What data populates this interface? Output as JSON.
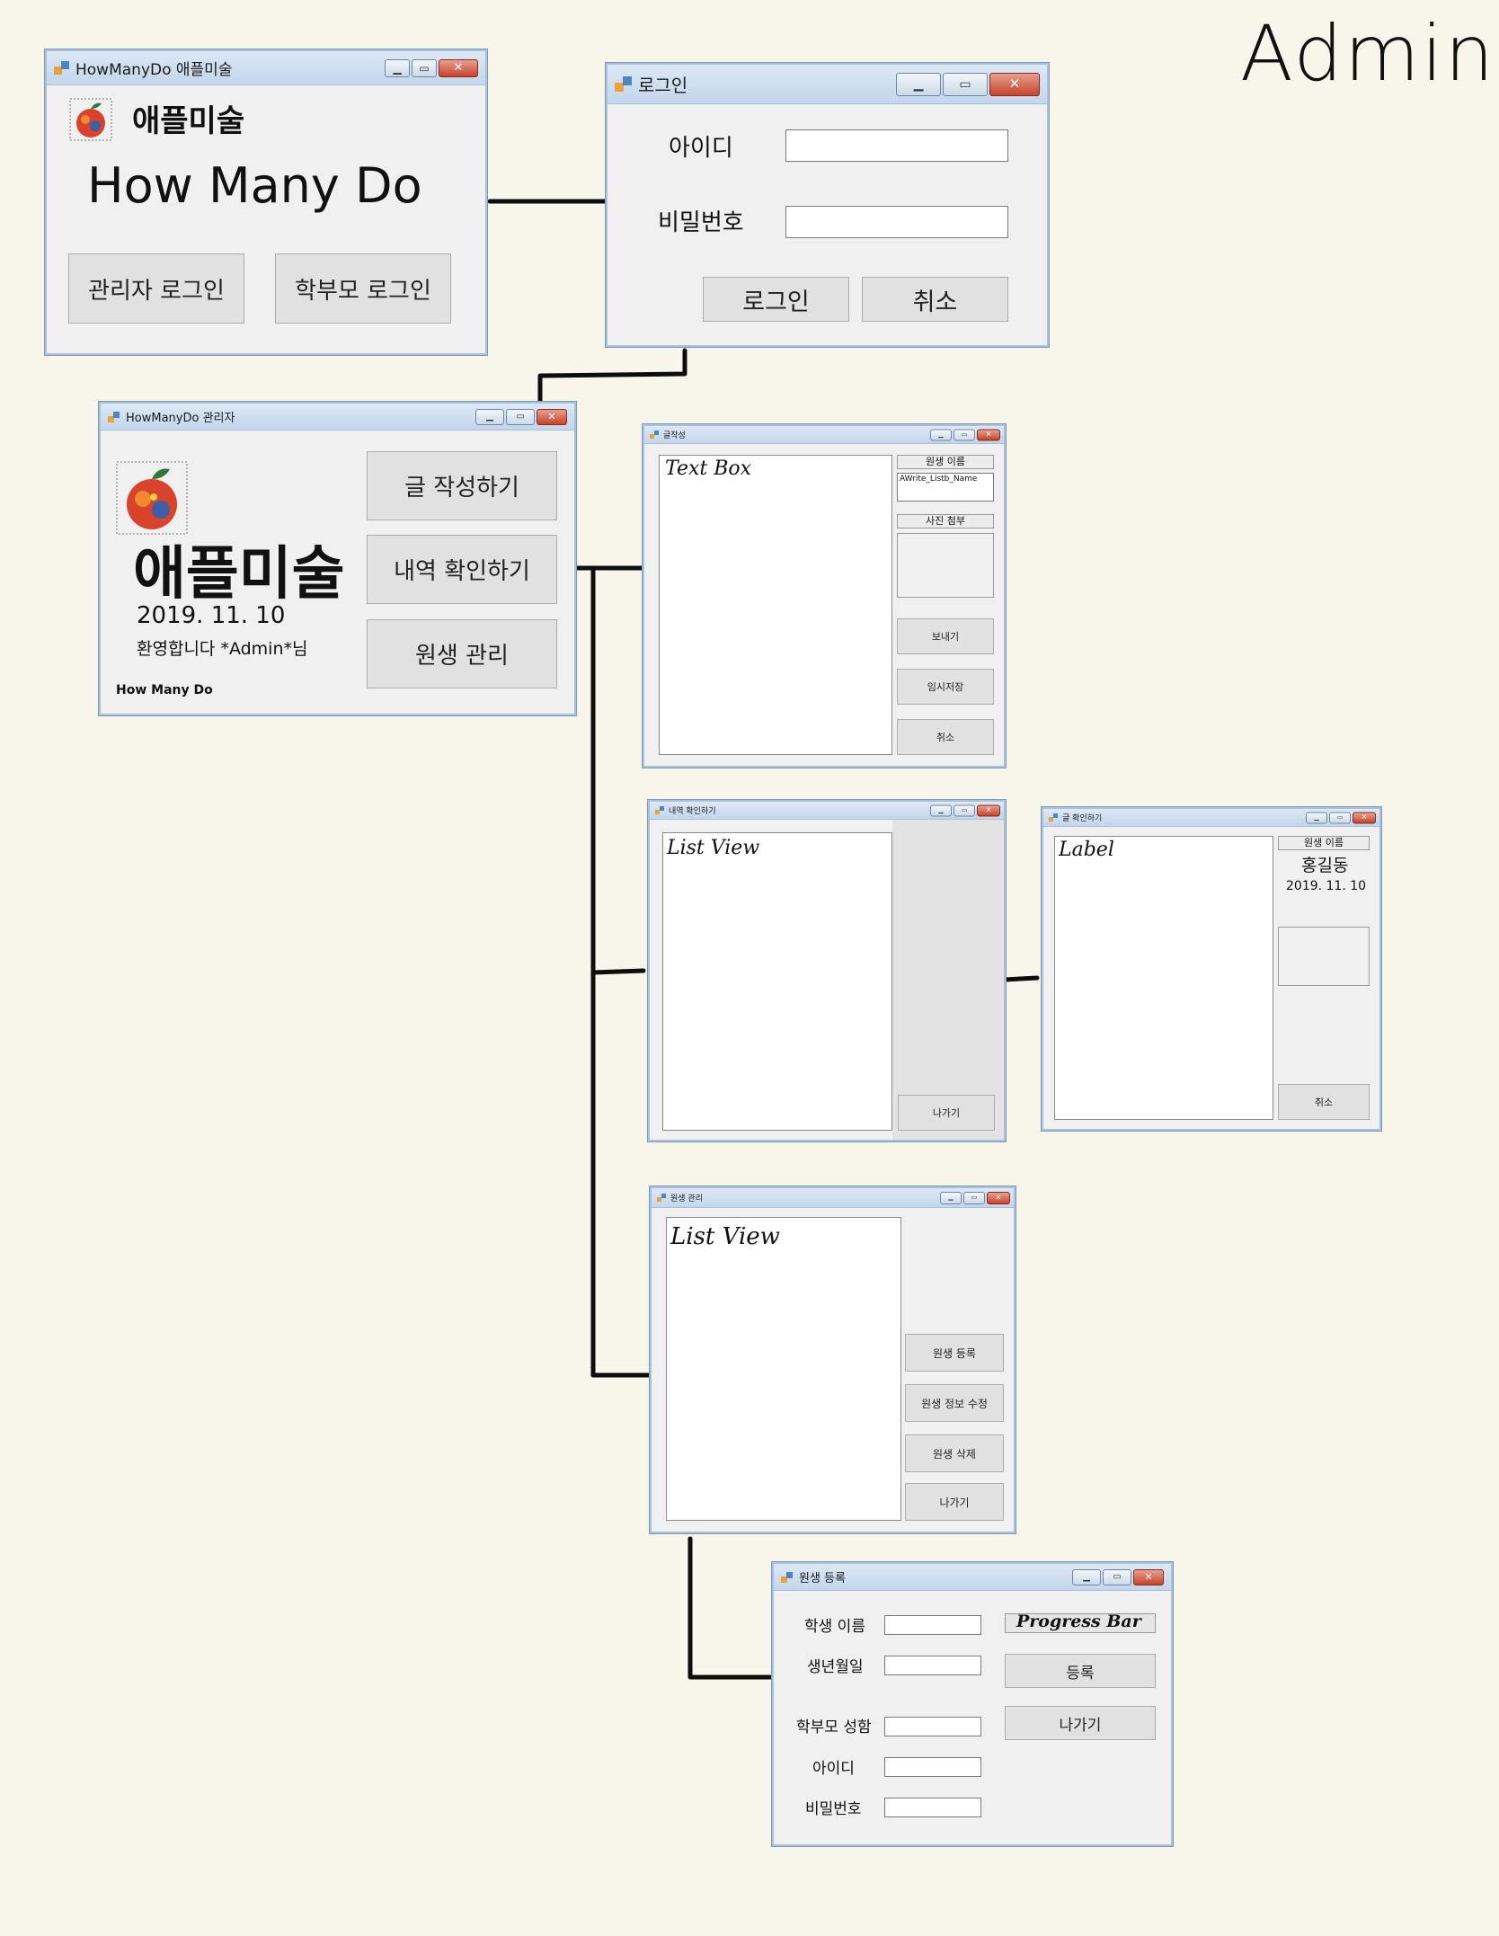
{
  "heading": "Admin",
  "main_window": {
    "title": "HowManyDo 애플미술",
    "brand": "애플미술",
    "app_name": "How Many Do",
    "admin_login": "관리자 로그인",
    "parent_login": "학부모 로그인"
  },
  "login_window": {
    "title": "로그인",
    "id_label": "아이디",
    "pw_label": "비밀번호",
    "login_button": "로그인",
    "cancel_button": "취소"
  },
  "admin_window": {
    "title": "HowManyDo 관리자",
    "brand": "애플미술",
    "date": "2019. 11. 10",
    "welcome": "환영합니다 *Admin*님",
    "footer": "How Many Do",
    "write_button": "글 작성하기",
    "history_button": "내역 확인하기",
    "students_button": "원생 관리"
  },
  "write_window": {
    "title": "글작성",
    "main_note": "Text Box",
    "student_name_header": "원생 이름",
    "name_field": "AWrite_Listb_Name",
    "photo_header": "사진 첨부",
    "send_button": "보내기",
    "draft_button": "임시저장",
    "cancel_button": "취소"
  },
  "history_window": {
    "title": "내역 확인하기",
    "main_note": "List View",
    "exit_button": "나가기"
  },
  "post_window": {
    "title": "글 확인하기",
    "main_note": "Label",
    "student_name_header": "원생 이름",
    "student_name": "홍길동",
    "date": "2019. 11. 10",
    "cancel_button": "취소"
  },
  "manage_window": {
    "title": "원생 관리",
    "main_note": "List View",
    "register_button": "원생 등록",
    "edit_button": "원생 정보 수정",
    "delete_button": "원생 삭제",
    "exit_button": "나가기"
  },
  "register_window": {
    "title": "원생 등록",
    "student_name_label": "학생 이름",
    "birth_label": "생년월일",
    "parent_name_label": "학부모 성함",
    "id_label": "아이디",
    "pw_label": "비밀번호",
    "progress_note": "Progress Bar",
    "register_button": "등록",
    "exit_button": "나가기"
  }
}
